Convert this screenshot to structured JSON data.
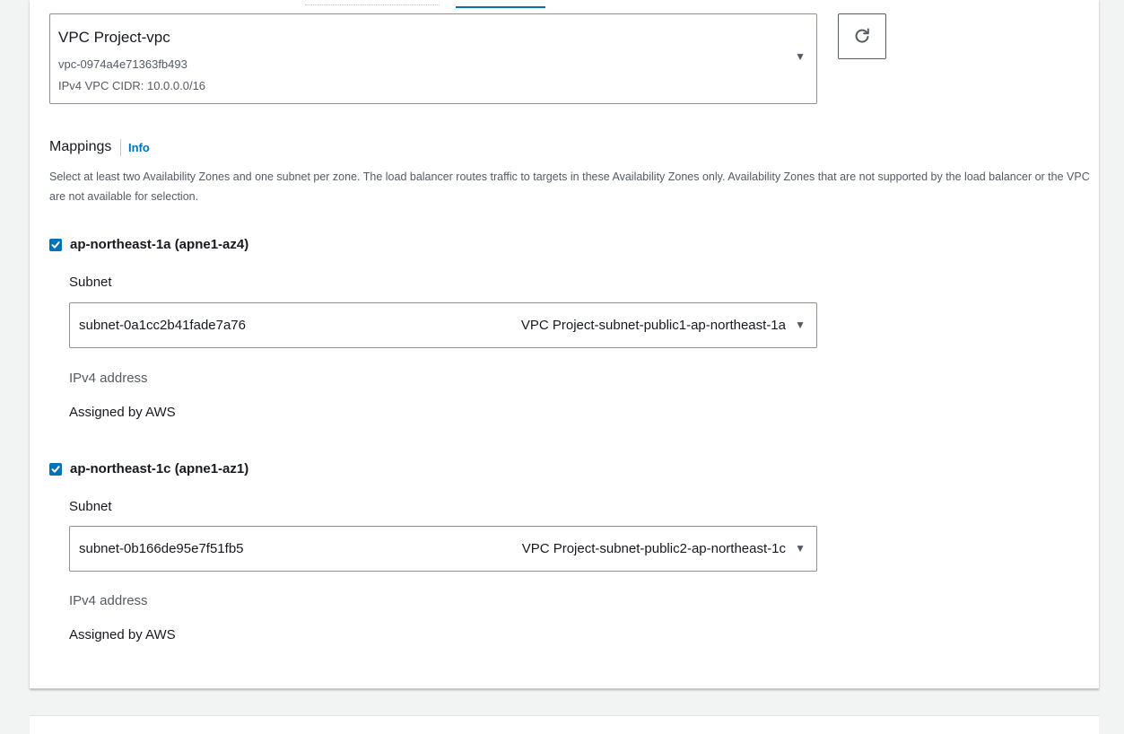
{
  "vpc": {
    "name": "VPC Project-vpc",
    "id": "vpc-0974a4e71363fb493",
    "cidr": "IPv4 VPC CIDR: 10.0.0.0/16"
  },
  "mappings": {
    "title": "Mappings",
    "info_label": "Info",
    "description": "Select at least two Availability Zones and one subnet per zone. The load balancer routes traffic to targets in these Availability Zones only. Availability Zones that are not supported by the load balancer or the VPC are not available for selection.",
    "zones": [
      {
        "label": "ap-northeast-1a (apne1-az4)",
        "checked": true,
        "subnet_label": "Subnet",
        "subnet_id": "subnet-0a1cc2b41fade7a76",
        "subnet_name": "VPC Project-subnet-public1-ap-northeast-1a",
        "ipv4_label": "IPv4 address",
        "ipv4_value": "Assigned by AWS"
      },
      {
        "label": "ap-northeast-1c (apne1-az1)",
        "checked": true,
        "subnet_label": "Subnet",
        "subnet_id": "subnet-0b166de95e7f51fb5",
        "subnet_name": "VPC Project-subnet-public2-ap-northeast-1c",
        "ipv4_label": "IPv4 address",
        "ipv4_value": "Assigned by AWS"
      }
    ]
  },
  "icons": {
    "refresh": "refresh-icon",
    "dropdown": "caret-down-icon",
    "check": "check-icon"
  },
  "colors": {
    "accent": "#0073bb",
    "text": "#16191f",
    "muted_text": "#545b64",
    "border": "#8d9096",
    "background": "#f2f3f3"
  }
}
